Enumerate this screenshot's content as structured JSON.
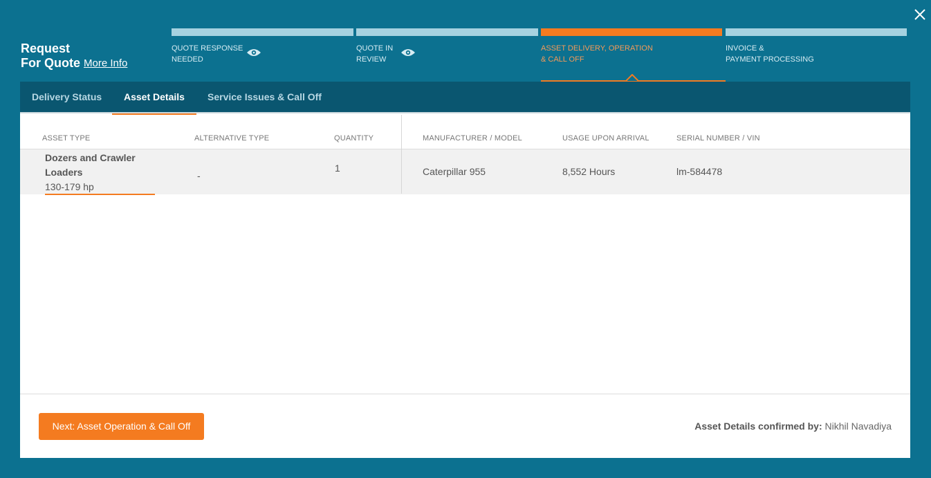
{
  "header": {
    "title_line1": "Request",
    "title_line2": "For Quote",
    "more_info": "More Info",
    "close_icon": "close-icon"
  },
  "steps": [
    {
      "label": "QUOTE RESPONSE\nNEEDED",
      "icon": "eye-icon",
      "state": "complete"
    },
    {
      "label": "QUOTE IN\nREVIEW",
      "icon": "eye-icon",
      "state": "complete"
    },
    {
      "label": "ASSET DELIVERY, OPERATION\n& CALL OFF",
      "state": "active"
    },
    {
      "label": "INVOICE &\nPAYMENT PROCESSING",
      "state": "upcoming"
    }
  ],
  "tabs": [
    "Delivery Status",
    "Asset Details",
    "Service Issues & Call Off"
  ],
  "active_tab": "Asset Details",
  "table": {
    "headers": [
      "ASSET TYPE",
      "ALTERNATIVE TYPE",
      "QUANTITY",
      "MANUFACTURER / MODEL",
      "USAGE UPON ARRIVAL",
      "SERIAL NUMBER / VIN"
    ],
    "row": {
      "asset_type_line1": "Dozers and Crawler",
      "asset_type_line2": "Loaders",
      "asset_size": "130-179 hp",
      "alternative_type": "-",
      "quantity": "1",
      "manufacturer_model": "Caterpillar 955",
      "usage": "8,552 Hours",
      "serial": "lm-584478"
    }
  },
  "footer": {
    "next_button": "Next: Asset Operation & Call Off",
    "confirmed_label": "Asset Details confirmed by:",
    "confirmed_name": "Nikhil Navadiya"
  },
  "colors": {
    "background": "#0c7190",
    "accent": "#f47b20",
    "tab_bar": "#0a5670"
  }
}
